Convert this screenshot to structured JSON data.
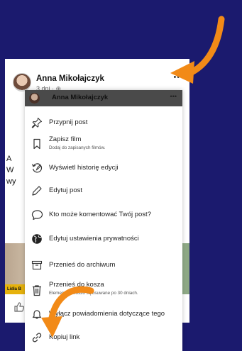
{
  "post": {
    "author": "Anna Mikołajczyk",
    "meta": "3 dni · ⊕",
    "more": "•••",
    "left_lines": [
      "A",
      "W",
      "wy"
    ],
    "image_label": "Lidia B",
    "like_icon": "thumbs-up-icon"
  },
  "menu": {
    "header_name": "Anna Mikołajczyk",
    "header_more": "•••",
    "items": [
      {
        "label": "Przypnij post",
        "icon": "pin-icon"
      },
      {
        "label": "Zapisz film",
        "sub": "Dodaj do zapisanych filmów.",
        "icon": "bookmark-icon"
      },
      {
        "label": "Wyświetl historię edycji",
        "icon": "history-icon"
      },
      {
        "label": "Edytuj post",
        "icon": "pencil-icon"
      },
      {
        "label": "Kto może komentować Twój post?",
        "icon": "comment-icon"
      },
      {
        "label": "Edytuj ustawienia prywatności",
        "icon": "globe-icon"
      },
      {
        "label": "Przenieś do archiwum",
        "icon": "archive-icon"
      },
      {
        "label": "Przenieś do kosza",
        "sub": "Elementy w koszu są usuwane po 30 dniach.",
        "icon": "trash-icon"
      },
      {
        "label": "Wyłącz powiadomienia dotyczące tego",
        "icon": "bell-icon"
      },
      {
        "label": "Kopiuj link",
        "icon": "link-icon"
      }
    ]
  },
  "colors": {
    "background": "#1b1a6e",
    "arrow": "#f28a17"
  }
}
